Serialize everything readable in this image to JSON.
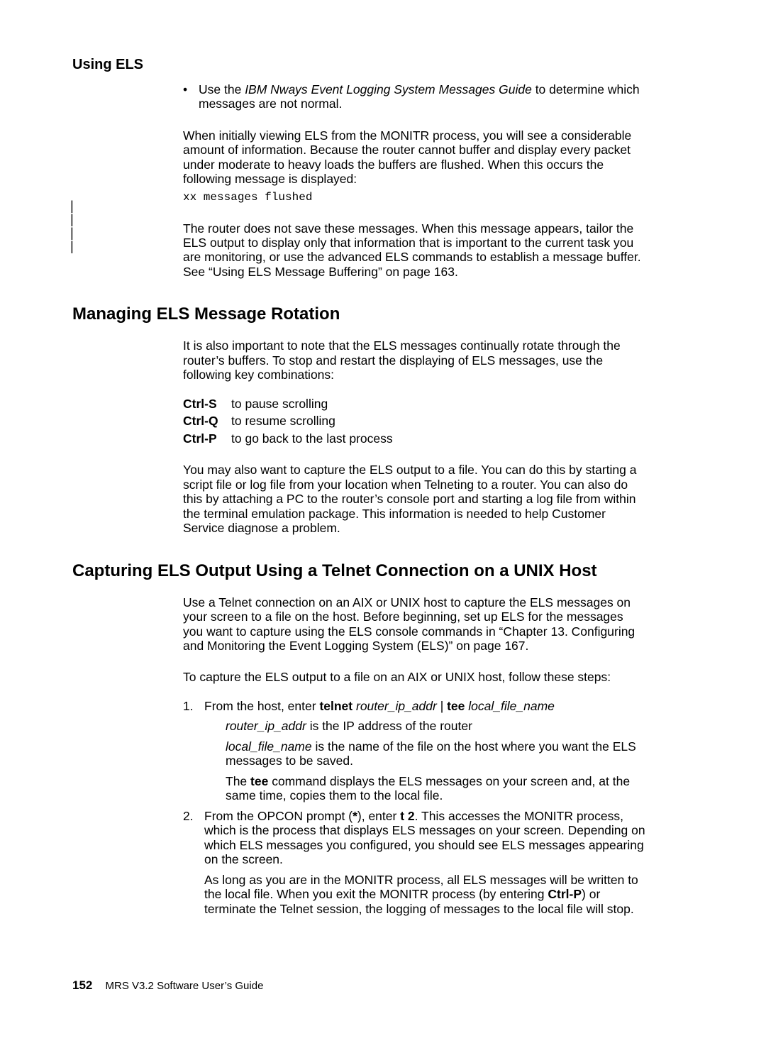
{
  "header": {
    "running": "Using ELS"
  },
  "bullet": {
    "lead": "Use the ",
    "emTitle": "IBM Nways Event Logging System Messages Guide",
    "tail": " to determine which messages are not normal."
  },
  "p1": "When initially viewing ELS from the MONITR process, you will see a considerable amount of information. Because the router cannot buffer and display every packet under moderate to heavy loads the buffers are flushed. When this occurs the following message is displayed:",
  "code1": "xx messages flushed",
  "p2": "The router does not save these messages. When this message appears, tailor the ELS output to display only that information that is important to the current task you are monitoring, or use the advanced ELS commands to establish a message buffer. See “Using ELS Message Buffering” on page 163.",
  "h_rotation": "Managing ELS Message Rotation",
  "rot_p1": "It is also important to note that the ELS messages continually rotate through the router’s buffers. To stop and restart the displaying of ELS messages, use the following key combinations:",
  "keys": [
    {
      "k": "Ctrl-S",
      "d": "to pause scrolling"
    },
    {
      "k": "Ctrl-Q",
      "d": "to resume scrolling"
    },
    {
      "k": "Ctrl-P",
      "d": "to go back to the last process"
    }
  ],
  "rot_p2": "You may also want to capture the ELS output to a file. You can do this by starting a script file or log file from your location when Telneting to a router. You can also do this by attaching a PC to the router’s console port and starting a log file from within the terminal emulation package. This information is needed to help Customer Service diagnose a problem.",
  "h_capture": "Capturing ELS Output Using a Telnet Connection on a UNIX Host",
  "cap_p1": "Use a Telnet connection on an AIX or UNIX host to capture the ELS messages on your screen to a file on the host. Before beginning, set up ELS for the messages you want to capture using the ELS console commands in “Chapter 13. Configuring and Monitoring the Event Logging System (ELS)” on page 167.",
  "cap_p2": "To capture the ELS output to a file on an AIX or UNIX host, follow these steps:",
  "step1": {
    "lead": "From the host, enter ",
    "cmd1": "telnet",
    "arg1": "router_ip_addr",
    "pipe": " | ",
    "cmd2": "tee",
    "arg2": "local_file_name",
    "sub1_em": "router_ip_addr",
    "sub1_tail": " is the IP address of the router",
    "sub2_em": "local_file_name",
    "sub2_tail": " is the name of the file on the host where you want the ELS messages to be saved.",
    "sub3_a": "The ",
    "sub3_b": "tee",
    "sub3_c": " command displays the ELS messages on your screen and, at the same time, copies them to the local file."
  },
  "step2": {
    "a": "From the OPCON prompt (",
    "star": "*",
    "b": "), enter ",
    "cmd": "t 2",
    "c": ". This accesses the MONITR process, which is the process that displays ELS messages on your screen. Depending on which ELS messages you configured, you should see ELS messages appearing on the screen.",
    "sub_a": "As long as you are in the MONITR process, all ELS messages will be written to the local file. When you exit the MONITR process (by entering ",
    "sub_b": "Ctrl-P",
    "sub_c": ") or terminate the Telnet session, the logging of messages to the local file will stop."
  },
  "footer": {
    "page": "152",
    "title": "MRS V3.2 Software User’s Guide"
  }
}
